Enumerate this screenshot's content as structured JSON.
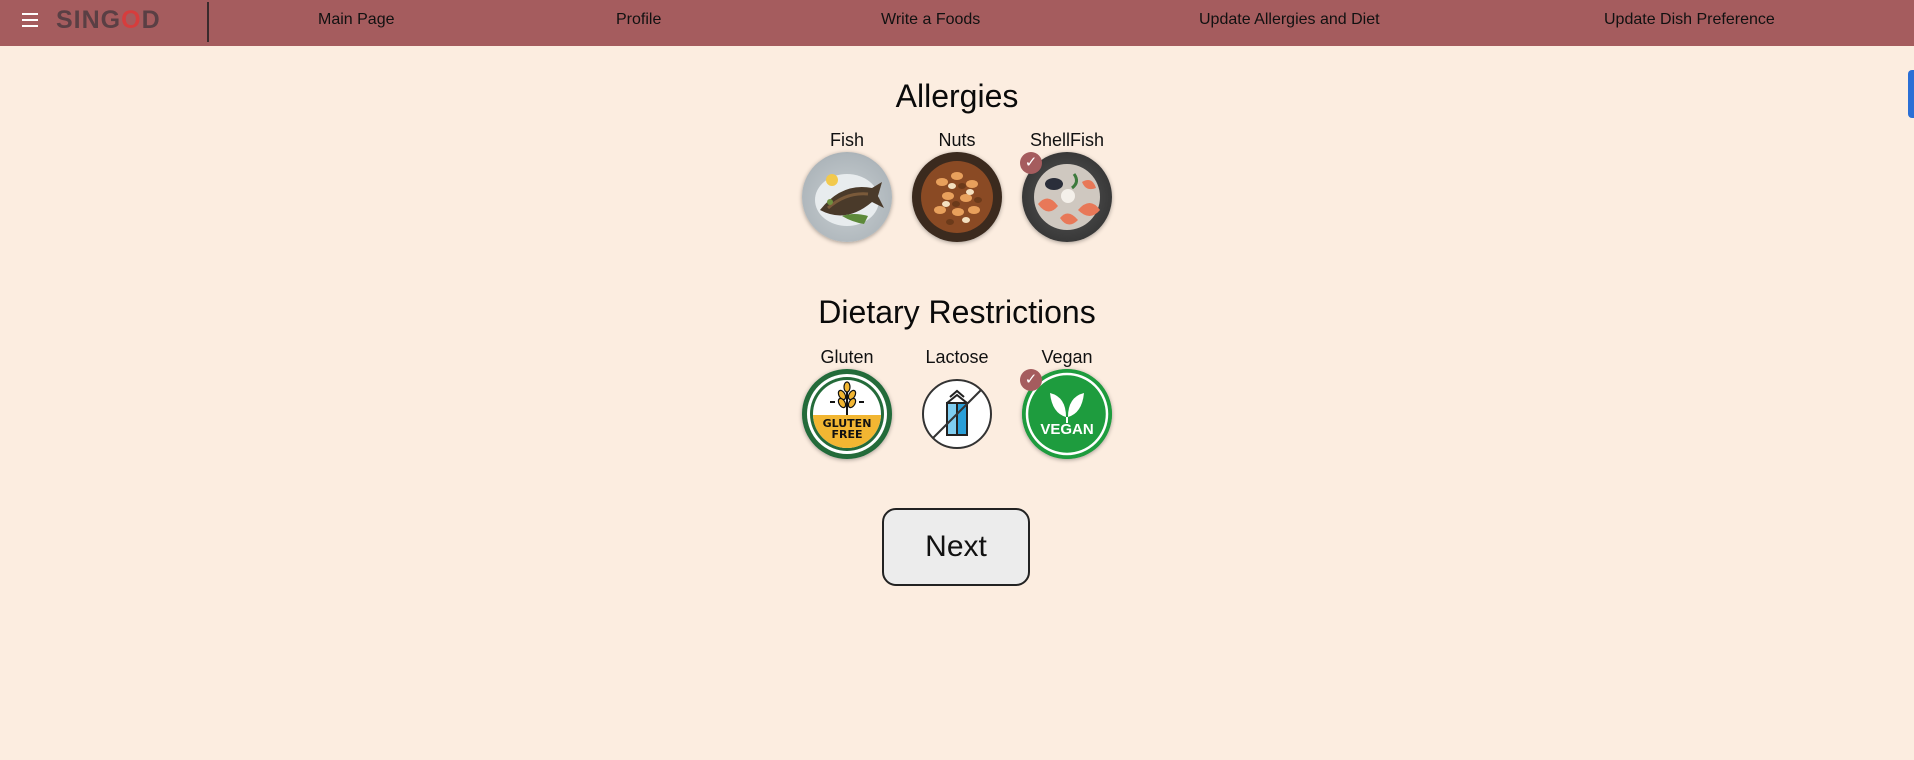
{
  "header": {
    "logo_text_start": "SING",
    "logo_text_o": "O",
    "logo_text_end": "D",
    "nav": {
      "main_page": "Main Page",
      "profile": "Profile",
      "write_foods": "Write a Foods",
      "update_allergies": "Update Allergies and Diet",
      "update_dish": "Update Dish Preference"
    }
  },
  "allergies": {
    "title": "Allergies",
    "items": [
      {
        "label": "Fish",
        "selected": false
      },
      {
        "label": "Nuts",
        "selected": false
      },
      {
        "label": "ShellFish",
        "selected": true
      }
    ]
  },
  "dietary": {
    "title": "Dietary Restrictions",
    "items": [
      {
        "label": "Gluten",
        "selected": false,
        "badge_line1": "GLUTEN",
        "badge_line2": "FREE"
      },
      {
        "label": "Lactose",
        "selected": false
      },
      {
        "label": "Vegan",
        "selected": true,
        "badge_text": "VEGAN"
      }
    ]
  },
  "next_button": "Next",
  "checkmark": "✓",
  "colors": {
    "background": "#fcede0",
    "navbar": "#a55c5e",
    "check_badge": "#a55c5e"
  }
}
